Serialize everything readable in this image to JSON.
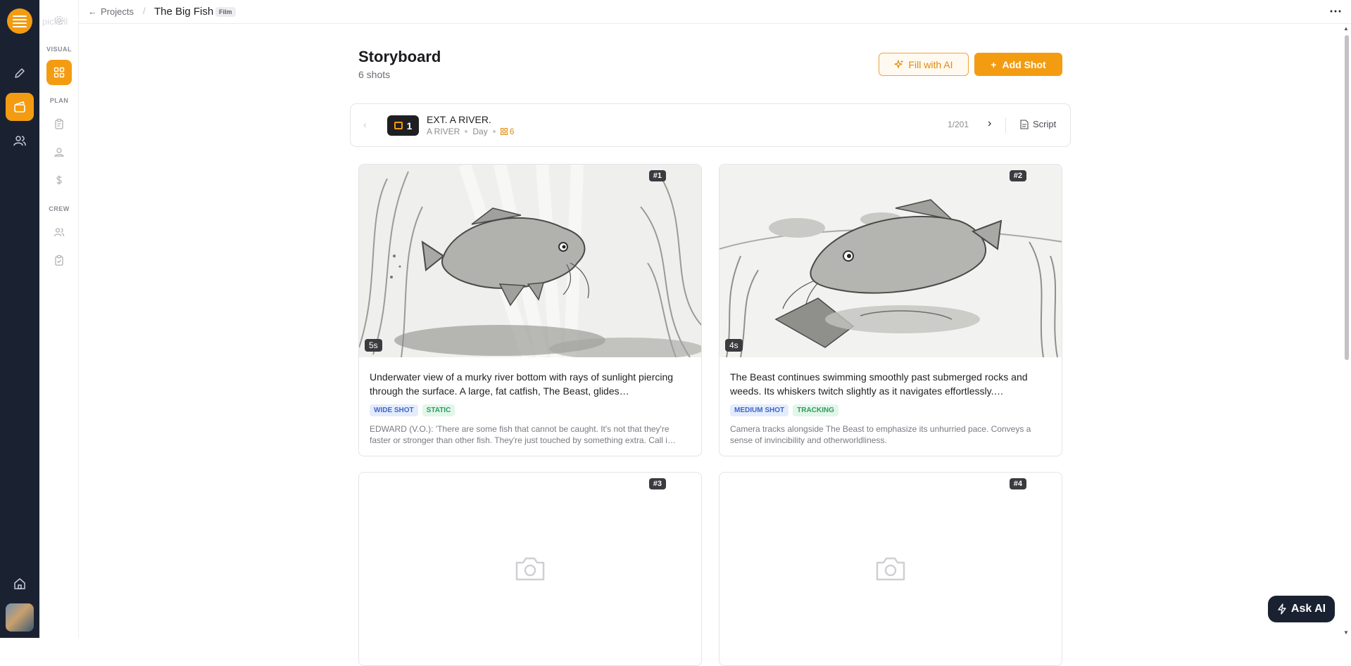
{
  "app": {
    "ghost_label": "pickell"
  },
  "nav": {
    "sections": {
      "visual": "VISUAL",
      "plan": "PLAN",
      "crew": "CREW"
    }
  },
  "breadcrumb": {
    "back": "Projects",
    "separator": "/",
    "title": "The Big Fish",
    "badge": "Film"
  },
  "page": {
    "title": "Storyboard",
    "count": "6 shots",
    "fill_ai_label": "Fill with AI",
    "add_shot_label": "Add Shot"
  },
  "scene": {
    "number": "1",
    "heading": "EXT. A RIVER.",
    "location": "A RIVER",
    "time": "Day",
    "shot_total": "6",
    "pager": "1/201",
    "script_label": "Script"
  },
  "shots": [
    {
      "number": "#1",
      "duration": "5s",
      "description": "Underwater view of a murky river bottom with rays of sunlight piercing through the surface. A large, fat catfish, The Beast, glides…",
      "tags": [
        "WIDE SHOT",
        "STATIC"
      ],
      "notes": "EDWARD (V.O.): 'There are some fish that cannot be caught. It's not that they're faster or stronger than other fish. They're just touched by something extra. Call i…"
    },
    {
      "number": "#2",
      "duration": "4s",
      "description": "The Beast continues swimming smoothly past submerged rocks and weeds. Its whiskers twitch slightly as it navigates effortlessly.…",
      "tags": [
        "MEDIUM SHOT",
        "TRACKING"
      ],
      "notes": "Camera tracks alongside The Beast to emphasize its unhurried pace. Conveys a sense of invincibility and otherworldliness."
    },
    {
      "number": "#3"
    },
    {
      "number": "#4"
    }
  ],
  "assistant": {
    "label": "Ask AI"
  },
  "colors": {
    "accent": "#f39c12",
    "rail": "#1a2232",
    "tag_blue": "#3f67c9",
    "tag_green": "#2a9d5f"
  }
}
